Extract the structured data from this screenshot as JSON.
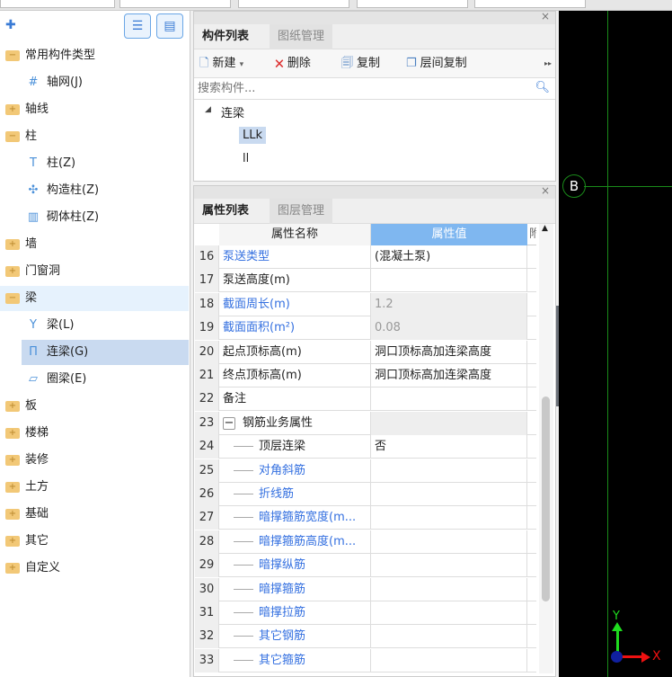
{
  "left": {
    "items": [
      {
        "label": "常用构件类型",
        "type": "folder",
        "expanded": true
      },
      {
        "label": "轴网(J)",
        "type": "child",
        "icon": "grid-icon"
      },
      {
        "label": "轴线",
        "type": "folder"
      },
      {
        "label": "柱",
        "type": "folder",
        "expanded": true
      },
      {
        "label": "柱(Z)",
        "type": "child",
        "icon": "column-icon"
      },
      {
        "label": "构造柱(Z)",
        "type": "child",
        "icon": "constructional-column-icon"
      },
      {
        "label": "砌体柱(Z)",
        "type": "child",
        "icon": "masonry-column-icon"
      },
      {
        "label": "墙",
        "type": "folder"
      },
      {
        "label": "门窗洞",
        "type": "folder"
      },
      {
        "label": "梁",
        "type": "folder",
        "expanded": true,
        "highlight": true
      },
      {
        "label": "梁(L)",
        "type": "child",
        "icon": "beam-icon"
      },
      {
        "label": "连梁(G)",
        "type": "child",
        "icon": "coupling-beam-icon",
        "selected": true
      },
      {
        "label": "圈梁(E)",
        "type": "child",
        "icon": "ring-beam-icon"
      },
      {
        "label": "板",
        "type": "folder"
      },
      {
        "label": "楼梯",
        "type": "folder"
      },
      {
        "label": "装修",
        "type": "folder"
      },
      {
        "label": "土方",
        "type": "folder"
      },
      {
        "label": "基础",
        "type": "folder"
      },
      {
        "label": "其它",
        "type": "folder"
      },
      {
        "label": "自定义",
        "type": "folder"
      }
    ]
  },
  "components": {
    "tabs": [
      "构件列表",
      "图纸管理"
    ],
    "toolbar": {
      "new": "新建",
      "delete": "删除",
      "copy": "复制",
      "floor_copy": "层间复制"
    },
    "search_placeholder": "搜索构件...",
    "tree": {
      "group": "连梁",
      "items": [
        "LLk",
        "ll"
      ]
    }
  },
  "properties": {
    "tabs": [
      "属性列表",
      "图层管理"
    ],
    "headers": {
      "name": "属性名称",
      "value": "属性值",
      "extra": "附"
    },
    "rows": [
      {
        "n": "16",
        "name": "泵送类型",
        "value": "(混凝土泵)",
        "blue": true
      },
      {
        "n": "17",
        "name": "泵送高度(m)",
        "value": ""
      },
      {
        "n": "18",
        "name": "截面周长(m)",
        "value": "1.2",
        "blue": true,
        "readonly": true
      },
      {
        "n": "19",
        "name": "截面面积(m²)",
        "value": "0.08",
        "blue": true,
        "readonly": true
      },
      {
        "n": "20",
        "name": "起点顶标高(m)",
        "value": "洞口顶标高加连梁高度"
      },
      {
        "n": "21",
        "name": "终点顶标高(m)",
        "value": "洞口顶标高加连梁高度"
      },
      {
        "n": "22",
        "name": "备注",
        "value": ""
      },
      {
        "n": "23",
        "name": "钢筋业务属性",
        "value": "",
        "group": true
      },
      {
        "n": "24",
        "name": "顶层连梁",
        "value": "否",
        "child": true
      },
      {
        "n": "25",
        "name": "对角斜筋",
        "value": "",
        "child": true,
        "blue": true
      },
      {
        "n": "26",
        "name": "折线筋",
        "value": "",
        "child": true,
        "blue": true
      },
      {
        "n": "27",
        "name": "暗撑箍筋宽度(m...",
        "value": "",
        "child": true,
        "blue": true
      },
      {
        "n": "28",
        "name": "暗撑箍筋高度(m...",
        "value": "",
        "child": true,
        "blue": true
      },
      {
        "n": "29",
        "name": "暗撑纵筋",
        "value": "",
        "child": true,
        "blue": true
      },
      {
        "n": "30",
        "name": "暗撑箍筋",
        "value": "",
        "child": true,
        "blue": true
      },
      {
        "n": "31",
        "name": "暗撑拉筋",
        "value": "",
        "child": true,
        "blue": true
      },
      {
        "n": "32",
        "name": "其它钢筋",
        "value": "",
        "child": true,
        "blue": true
      },
      {
        "n": "33",
        "name": "其它箍筋",
        "value": "",
        "child": true,
        "blue": true
      }
    ]
  },
  "canvas": {
    "axis_label": "B",
    "x_label": "X",
    "y_label": "Y"
  }
}
